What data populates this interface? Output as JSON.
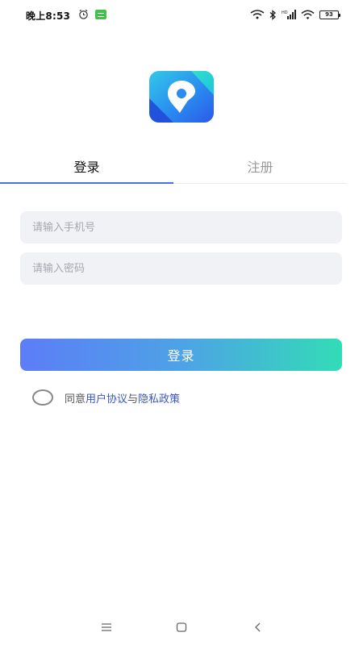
{
  "status_bar": {
    "time": "晚上8:53",
    "battery": "93",
    "icons": [
      "alarm-icon",
      "app-notification-icon",
      "wifi-hotspot-icon",
      "bluetooth-icon",
      "signal-icon",
      "wifi-icon",
      "battery-icon"
    ]
  },
  "app": {
    "logo_icon": "location-pin-logo-icon"
  },
  "tabs": {
    "login": "登录",
    "register": "注册",
    "active": "login",
    "accent_color": "#4a6cf0"
  },
  "form": {
    "phone_placeholder": "请输入手机号",
    "phone_value": "",
    "password_placeholder": "请输入密码",
    "password_value": "",
    "submit_label": "登录"
  },
  "agreement": {
    "prefix": "同意",
    "user_agreement": "用户协议",
    "conjunction": "与",
    "privacy_policy": "隐私政策",
    "checked": false,
    "link_color": "#3a56c4"
  },
  "nav_bar": {
    "icons": [
      "menu-icon",
      "home-icon",
      "back-icon"
    ]
  }
}
